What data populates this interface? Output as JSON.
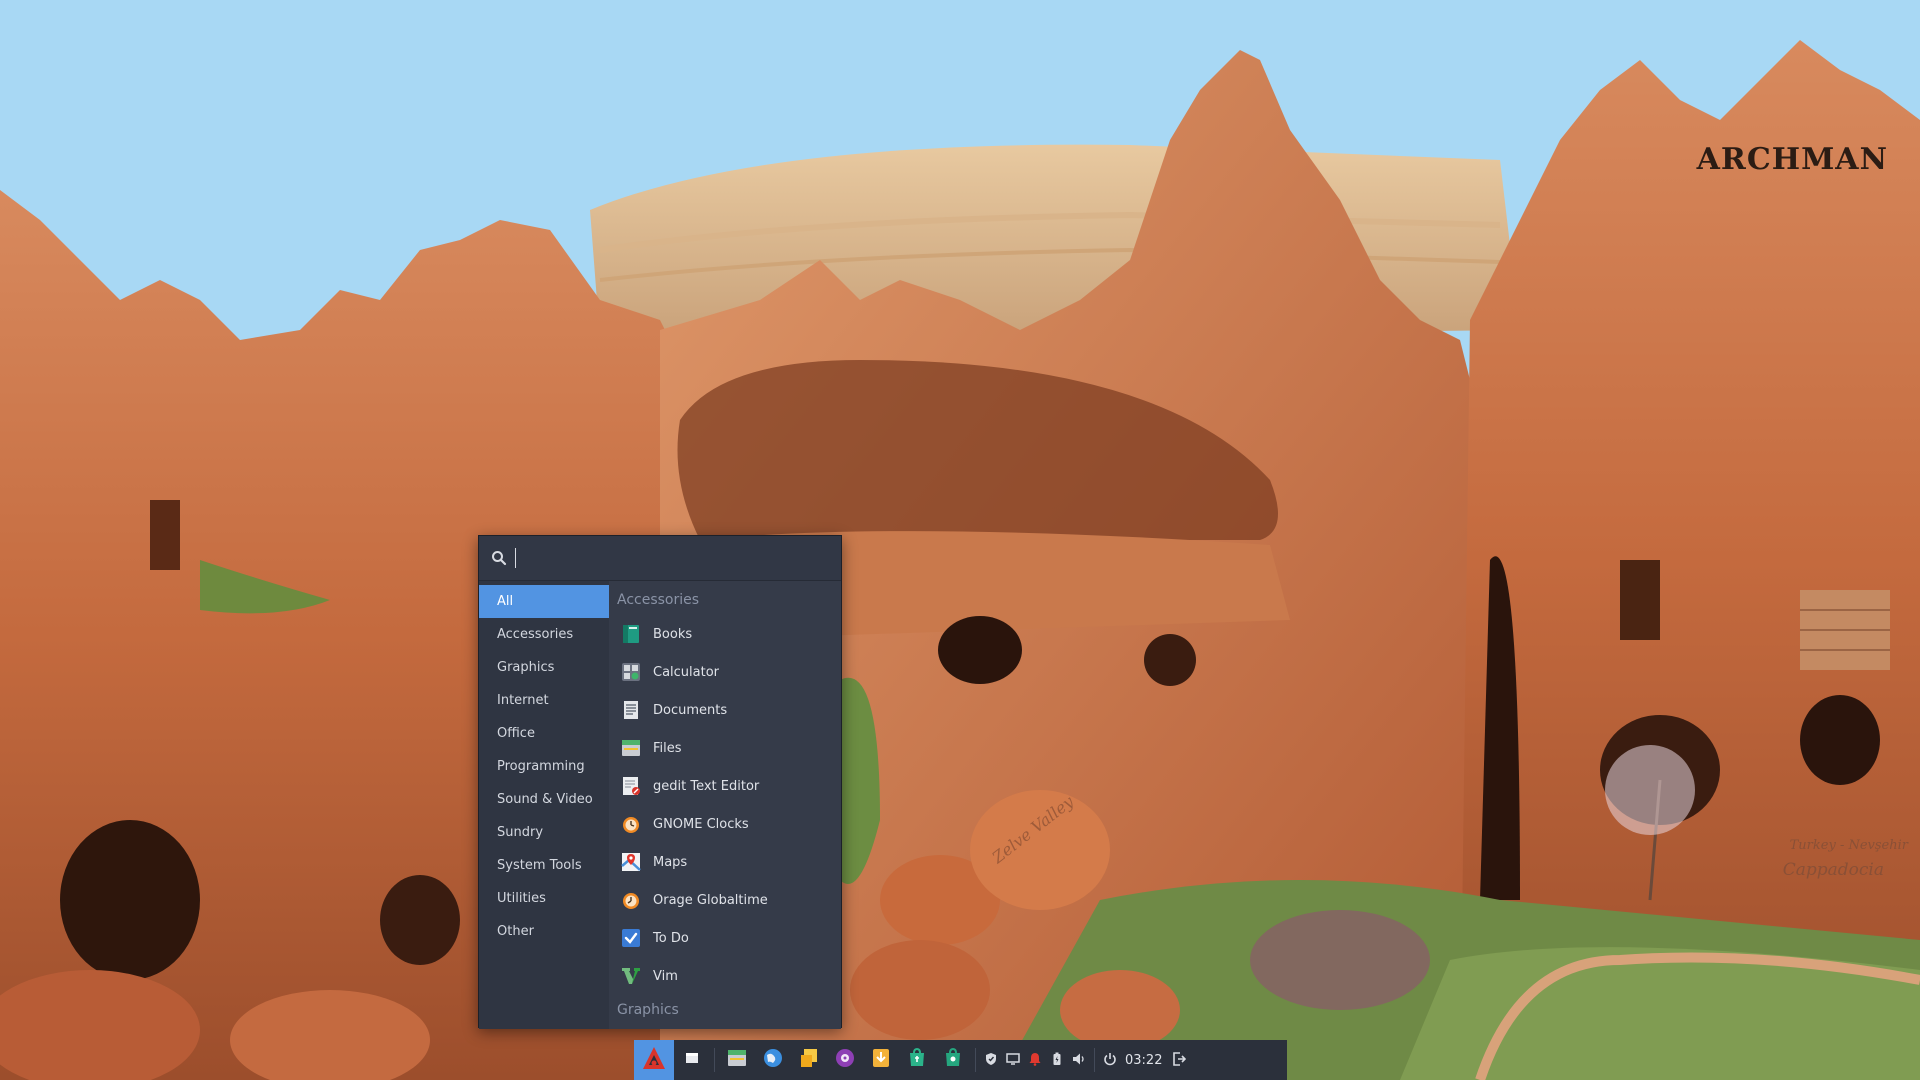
{
  "wallpaper": {
    "brand": "ARCHMAN",
    "place_country": "Turkey - Nevşehir",
    "place_region": "Cappadocia",
    "place_valley": "Zelve Valley"
  },
  "menu": {
    "search": {
      "value": "",
      "placeholder": ""
    },
    "categories": [
      {
        "label": "All",
        "active": true
      },
      {
        "label": "Accessories"
      },
      {
        "label": "Graphics"
      },
      {
        "label": "Internet"
      },
      {
        "label": "Office"
      },
      {
        "label": "Programming"
      },
      {
        "label": "Sound & Video"
      },
      {
        "label": "Sundry"
      },
      {
        "label": "System Tools"
      },
      {
        "label": "Utilities"
      },
      {
        "label": "Other"
      }
    ],
    "sections": [
      {
        "title": "Accessories",
        "apps": [
          {
            "label": "Books",
            "icon": "books-icon"
          },
          {
            "label": "Calculator",
            "icon": "calculator-icon"
          },
          {
            "label": "Documents",
            "icon": "documents-icon"
          },
          {
            "label": "Files",
            "icon": "files-icon"
          },
          {
            "label": "gedit Text Editor",
            "icon": "gedit-icon"
          },
          {
            "label": "GNOME Clocks",
            "icon": "clocks-icon"
          },
          {
            "label": "Maps",
            "icon": "maps-icon"
          },
          {
            "label": "Orage Globaltime",
            "icon": "globaltime-icon"
          },
          {
            "label": "To Do",
            "icon": "todo-icon"
          },
          {
            "label": "Vim",
            "icon": "vim-icon"
          }
        ]
      },
      {
        "title": "Graphics",
        "apps": []
      }
    ]
  },
  "taskbar": {
    "clock": "03:22",
    "launchers": [
      "show-desktop-icon",
      "file-manager-icon",
      "web-browser-icon",
      "file-folder-icon",
      "media-player-icon",
      "downloader-icon",
      "software-store-icon",
      "app-store-icon"
    ],
    "tray": [
      "shield-icon",
      "display-icon",
      "notification-bell-icon",
      "battery-icon",
      "volume-icon",
      "power-icon"
    ],
    "accent": "#5294e2"
  }
}
